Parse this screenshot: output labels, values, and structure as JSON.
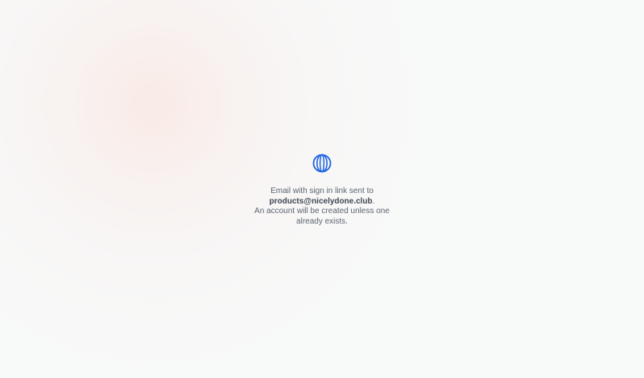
{
  "confirmation": {
    "logo_icon": "globe-ring-icon",
    "accent_color": "#1f63e0",
    "line1": "Email with sign in link sent to",
    "email": "products@nicelydone.club",
    "email_suffix": ".",
    "line3": "An account will be created unless one already exists."
  }
}
